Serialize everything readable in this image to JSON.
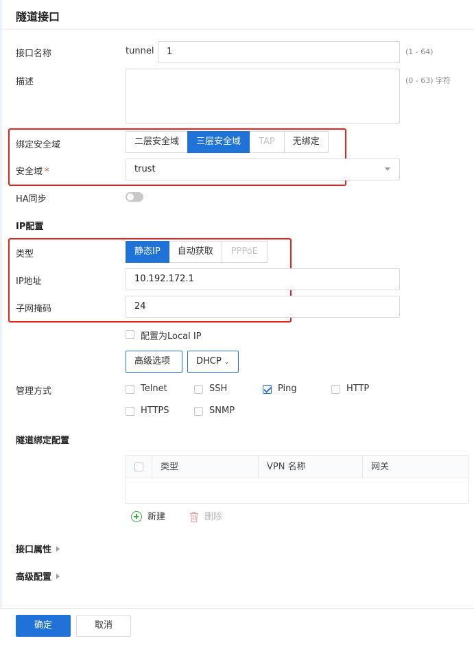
{
  "title": "隧道接口",
  "name_field": {
    "label": "接口名称",
    "prefix": "tunnel",
    "value": "1",
    "hint": "(1 - 64)"
  },
  "desc_field": {
    "label": "描述",
    "value": "",
    "hint": "(0 - 63) 字符"
  },
  "bind_zone": {
    "label": "绑定安全域",
    "options": [
      "二层安全域",
      "三层安全域",
      "TAP",
      "无绑定"
    ],
    "selected": "三层安全域",
    "disabled": [
      "TAP"
    ]
  },
  "zone": {
    "label": "安全域",
    "required_mark": "*",
    "value": "trust"
  },
  "ha_sync": {
    "label": "HA同步",
    "enabled": false
  },
  "ip_config": {
    "section_title": "IP配置",
    "type_label": "类型",
    "type_options": [
      "静态IP",
      "自动获取",
      "PPPoE"
    ],
    "type_selected": "静态IP",
    "type_disabled": [
      "PPPoE"
    ],
    "ip_label": "IP地址",
    "ip_value": "10.192.172.1",
    "mask_label": "子网掩码",
    "mask_value": "24",
    "local_ip_label": "配置为Local IP",
    "local_ip_checked": false,
    "advanced_button": "高级选项",
    "dhcp_button": "DHCP"
  },
  "management": {
    "label": "管理方式",
    "items": [
      {
        "label": "Telnet",
        "checked": false
      },
      {
        "label": "SSH",
        "checked": false
      },
      {
        "label": "Ping",
        "checked": true
      },
      {
        "label": "HTTP",
        "checked": false
      },
      {
        "label": "HTTPS",
        "checked": false
      },
      {
        "label": "SNMP",
        "checked": false
      }
    ]
  },
  "tunnel_binding": {
    "section_title": "隧道绑定配置",
    "columns": [
      "类型",
      "VPN 名称",
      "网关"
    ],
    "rows": [],
    "new_label": "新建",
    "delete_label": "删除"
  },
  "interface_props": {
    "label": "接口属性"
  },
  "advanced_config": {
    "label": "高级配置"
  },
  "footer": {
    "ok": "确定",
    "cancel": "取消"
  },
  "colors": {
    "primary": "#1f73d8",
    "highlight_box": "#e8221b",
    "success": "#38a946"
  }
}
